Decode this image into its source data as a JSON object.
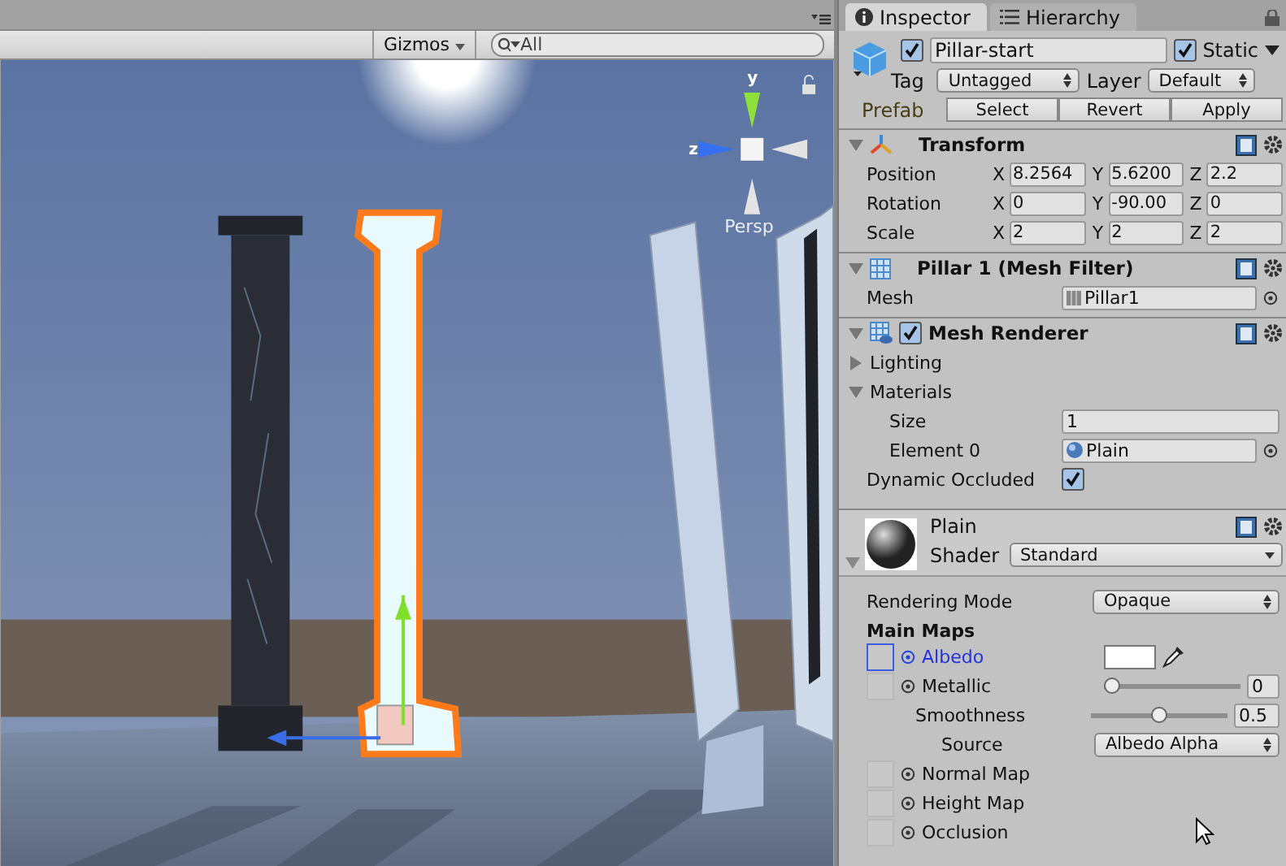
{
  "scene_view": {
    "gizmos_label": "Gizmos",
    "search": {
      "value": "All"
    },
    "gizmo": {
      "y_label": "y",
      "z_label": "z"
    },
    "projection": "Persp"
  },
  "tabs": [
    {
      "label": "Inspector",
      "selected": true
    },
    {
      "label": "Hierarchy",
      "selected": false
    }
  ],
  "object": {
    "active": true,
    "name": "Pillar-start",
    "static": true,
    "static_label": "Static",
    "tag_label": "Tag",
    "tag": "Untagged",
    "layer_label": "Layer",
    "layer": "Default",
    "prefab_label": "Prefab",
    "prefab_buttons": [
      "Select",
      "Revert",
      "Apply"
    ]
  },
  "transform": {
    "title": "Transform",
    "expanded": true,
    "rows": [
      {
        "label": "Position",
        "values": [
          {
            "axis": "X",
            "value": "8.2564"
          },
          {
            "axis": "Y",
            "value": "5.6200"
          },
          {
            "axis": "Z",
            "value": "2.2"
          }
        ]
      },
      {
        "label": "Rotation",
        "values": [
          {
            "axis": "X",
            "value": "0"
          },
          {
            "axis": "Y",
            "value": "-90.00"
          },
          {
            "axis": "Z",
            "value": "0"
          }
        ]
      },
      {
        "label": "Scale",
        "values": [
          {
            "axis": "X",
            "value": "2"
          },
          {
            "axis": "Y",
            "value": "2"
          },
          {
            "axis": "Z",
            "value": "2"
          }
        ]
      }
    ]
  },
  "mesh_filter": {
    "title": "Pillar 1 (Mesh Filter)",
    "expanded": true,
    "mesh_label": "Mesh",
    "mesh": "Pillar1"
  },
  "mesh_renderer": {
    "title": "Mesh Renderer",
    "expanded": true,
    "enabled": true,
    "lighting": {
      "label": "Lighting",
      "expanded": false
    },
    "materials": {
      "label": "Materials",
      "expanded": true,
      "size_label": "Size",
      "size": "1",
      "elements": [
        {
          "label": "Element 0",
          "value": "Plain"
        }
      ]
    },
    "dynamic_occluded": {
      "label": "Dynamic Occluded",
      "checked": true
    }
  },
  "material": {
    "name": "Plain",
    "expanded": true,
    "shader_label": "Shader",
    "shader": "Standard",
    "rendering_mode_label": "Rendering Mode",
    "rendering_mode": "Opaque",
    "section": "Main Maps",
    "maps": [
      {
        "kind": "color",
        "label": "Albedo",
        "selected": true
      },
      {
        "kind": "slider",
        "label": "Metallic",
        "selected": false,
        "level": 0,
        "value": "0"
      },
      {
        "kind": "sub_slider",
        "label": "Smoothness",
        "level": 0.5,
        "value": "0.5"
      },
      {
        "kind": "sub_dropdown",
        "label": "Source",
        "value": "Albedo Alpha"
      },
      {
        "kind": "texture",
        "label": "Normal Map",
        "selected": false
      },
      {
        "kind": "texture",
        "label": "Height Map",
        "selected": false
      },
      {
        "kind": "texture",
        "label": "Occlusion",
        "selected": false
      }
    ]
  }
}
